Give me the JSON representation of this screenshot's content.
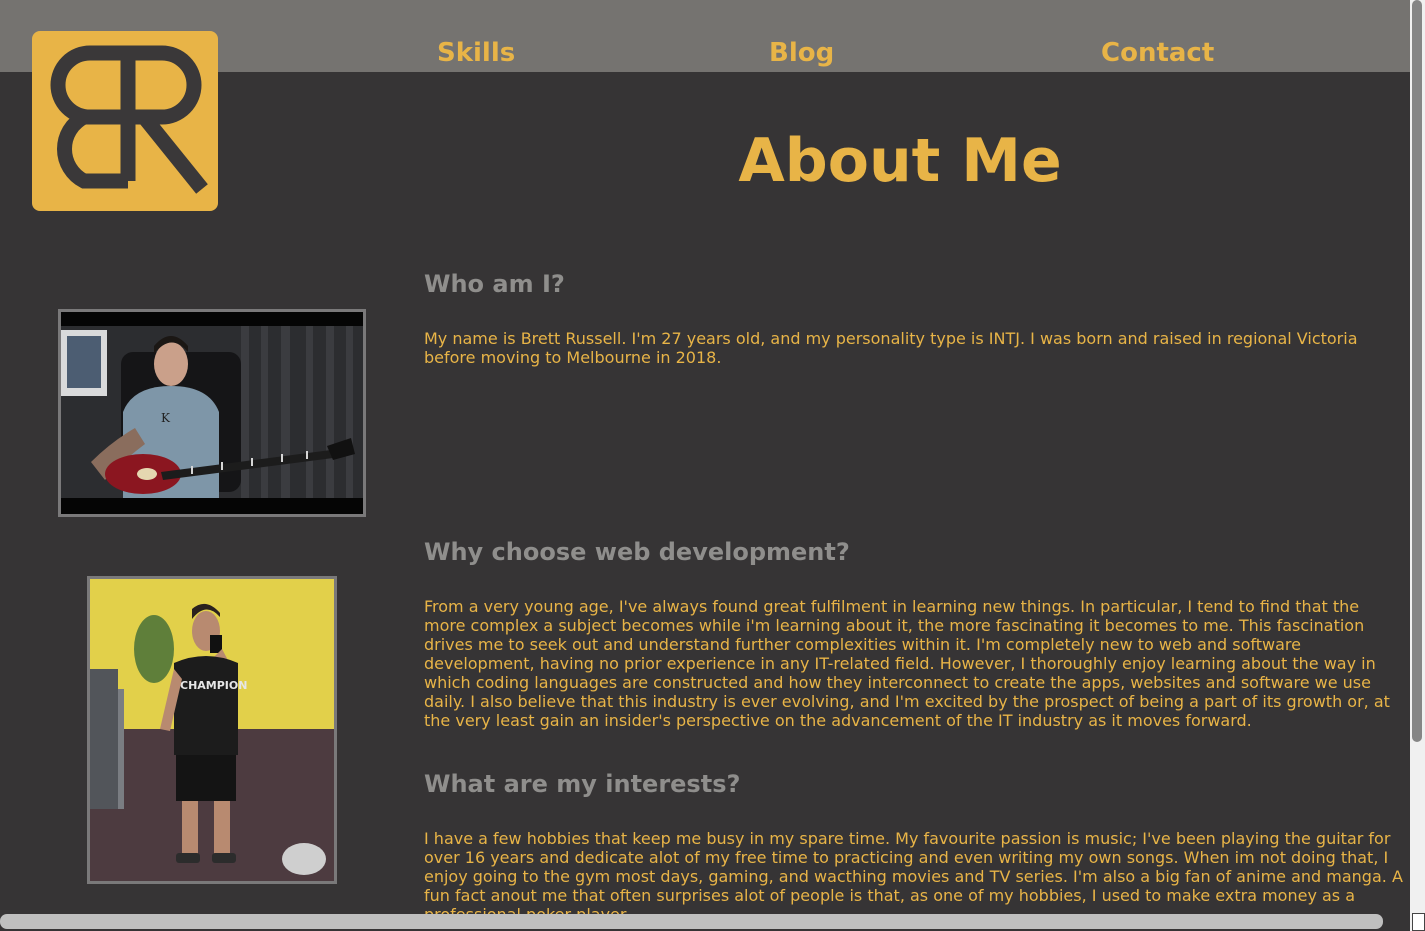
{
  "nav": {
    "items": [
      "Skills",
      "Blog",
      "Contact"
    ]
  },
  "logo": {
    "alt": "BR logo",
    "color": "#e8b447"
  },
  "page": {
    "title": "About Me"
  },
  "sections": [
    {
      "heading": "Who am I?",
      "text": "My name is Brett Russell. I'm 27 years old, and my personality type is INTJ. I was born and raised in regional Victoria before moving to Melbourne in 2018."
    },
    {
      "heading": "Why choose web development?",
      "text": "From a very young age, I've always found great fulfilment in learning new things. In particular, I tend to find that the more complex a subject becomes while i'm learning about it, the more fascinating it becomes to me. This fascination drives me to seek out and understand further complexities within it. I'm completely new to web and software development, having no prior experience in any IT-related field. However, I thoroughly enjoy learning about the way in which coding languages are constructed and how they interconnect to create the apps, websites and software we use daily. I also believe that this industry is ever evolving, and I'm excited by the prospect of being a part of its growth or, at the very least gain an insider's perspective on the advancement of the IT industry as it moves forward."
    },
    {
      "heading": "What are my interests?",
      "text": "I have a few hobbies that keep me busy in my spare time. My favourite passion is music; I've been playing the guitar for over 16 years and dedicate alot of my free time to practicing and even writing my own songs. When im not doing that, I enjoy going to the gym most days, gaming, and wacthing movies and TV series. I'm also a big fan of anime and manga. A fun fact anout me that often surprises alot of people is that, as one of my hobbies, I used to make extra money as a professional poker player."
    }
  ],
  "photos": [
    {
      "icon": "guitar-photo",
      "shirt_text": "K"
    },
    {
      "icon": "gym-selfie-photo",
      "shirt_text": "CHAMPION"
    }
  ],
  "colors": {
    "background": "#363435",
    "navbar": "#757370",
    "accent": "#e8b447",
    "heading_gray": "#8f8e8c"
  }
}
